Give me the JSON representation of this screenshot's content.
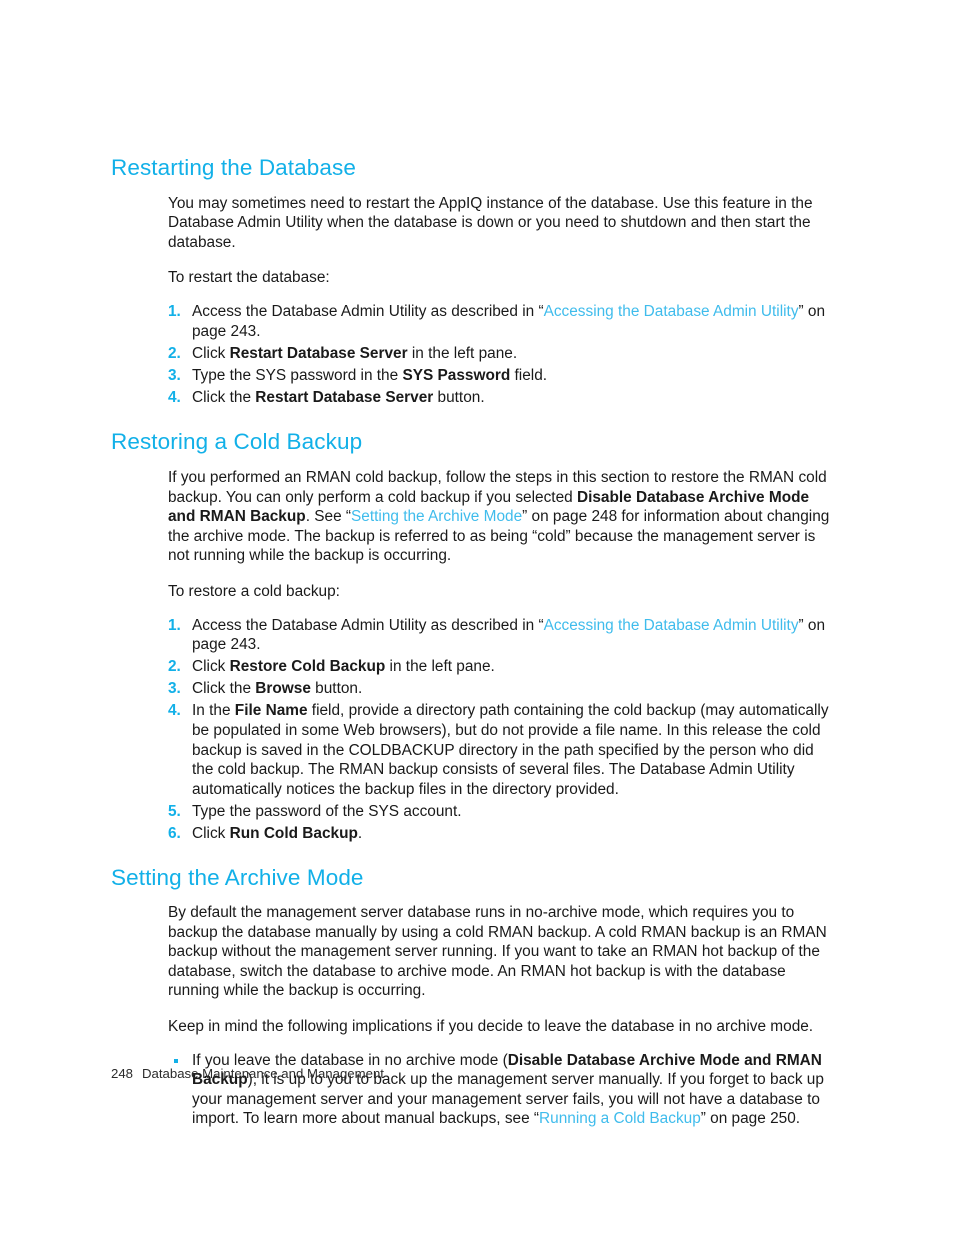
{
  "document": {
    "footer": {
      "page_number": "248",
      "chapter_title": "Database Maintenance and Management"
    }
  },
  "sections": [
    {
      "heading": "Restarting the Database",
      "intro": "You may sometimes need to restart the AppIQ instance of the database. Use this feature in the Database Admin Utility when the database is down or you need to shutdown and then start the database.",
      "lead_in": "To restart the database:",
      "steps": [
        {
          "number": "1.",
          "parts": [
            {
              "type": "text",
              "value": "Access the Database Admin Utility as described in “"
            },
            {
              "type": "xref",
              "value": "Accessing the Database Admin Utility"
            },
            {
              "type": "text",
              "value": "” on page 243."
            }
          ]
        },
        {
          "number": "2.",
          "parts": [
            {
              "type": "text",
              "value": "Click "
            },
            {
              "type": "bold",
              "value": "Restart Database Server"
            },
            {
              "type": "text",
              "value": " in the left pane."
            }
          ]
        },
        {
          "number": "3.",
          "parts": [
            {
              "type": "text",
              "value": "Type the SYS password in the "
            },
            {
              "type": "bold",
              "value": "SYS Password"
            },
            {
              "type": "text",
              "value": " field."
            }
          ]
        },
        {
          "number": "4.",
          "parts": [
            {
              "type": "text",
              "value": "Click the "
            },
            {
              "type": "bold",
              "value": "Restart Database Server"
            },
            {
              "type": "text",
              "value": " button."
            }
          ]
        }
      ]
    },
    {
      "heading": "Restoring a Cold Backup",
      "intro_parts": [
        {
          "type": "text",
          "value": "If you performed an RMAN cold backup, follow the steps in this section to restore the RMAN cold backup. You can only perform a cold backup if you selected "
        },
        {
          "type": "bold",
          "value": "Disable Database Archive Mode and RMAN Backup"
        },
        {
          "type": "text",
          "value": ". See “"
        },
        {
          "type": "xref",
          "value": "Setting the Archive Mode"
        },
        {
          "type": "text",
          "value": "” on page 248 for information about changing the archive mode. The backup is referred to as being “cold” because the management server is not running while the backup is occurring."
        }
      ],
      "lead_in": "To restore a cold backup:",
      "steps": [
        {
          "number": "1.",
          "parts": [
            {
              "type": "text",
              "value": "Access the Database Admin Utility as described in “"
            },
            {
              "type": "xref",
              "value": "Accessing the Database Admin Utility"
            },
            {
              "type": "text",
              "value": "” on page 243."
            }
          ]
        },
        {
          "number": "2.",
          "parts": [
            {
              "type": "text",
              "value": "Click "
            },
            {
              "type": "bold",
              "value": "Restore Cold Backup"
            },
            {
              "type": "text",
              "value": " in the left pane."
            }
          ]
        },
        {
          "number": "3.",
          "parts": [
            {
              "type": "text",
              "value": "Click the "
            },
            {
              "type": "bold",
              "value": "Browse"
            },
            {
              "type": "text",
              "value": " button."
            }
          ]
        },
        {
          "number": "4.",
          "parts": [
            {
              "type": "text",
              "value": "In the "
            },
            {
              "type": "bold",
              "value": "File Name"
            },
            {
              "type": "text",
              "value": " field, provide a directory path containing the cold backup (may automatically be populated in some Web browsers), but do not provide a file name. In this release the cold backup is saved in the COLDBACKUP directory in the path specified by the person who did the cold backup. The RMAN backup consists of several files. The Database Admin Utility automatically notices the backup files in the directory provided."
            }
          ]
        },
        {
          "number": "5.",
          "parts": [
            {
              "type": "text",
              "value": "Type the password of the SYS account."
            }
          ]
        },
        {
          "number": "6.",
          "parts": [
            {
              "type": "text",
              "value": "Click "
            },
            {
              "type": "bold",
              "value": "Run Cold Backup"
            },
            {
              "type": "text",
              "value": "."
            }
          ]
        }
      ]
    },
    {
      "heading": "Setting the Archive Mode",
      "intro": "By default the management server database runs in no-archive mode, which requires you to backup the database manually by using a cold RMAN backup. A cold RMAN backup is an RMAN backup without the management server running. If you want to take an RMAN hot backup of the database, switch the database to archive mode. An RMAN hot backup is with the database running while the backup is occurring.",
      "lead_in": "Keep in mind the following implications if you decide to leave the database in no archive mode.",
      "bullets": [
        {
          "parts": [
            {
              "type": "text",
              "value": "If you leave the database in no archive mode ("
            },
            {
              "type": "bold",
              "value": "Disable Database Archive Mode and RMAN Backup"
            },
            {
              "type": "text",
              "value": "), it is up to you to back up the management server manually. If you forget to back up your management server and your management server fails, you will not have a database to import. To learn more about manual backups, see “"
            },
            {
              "type": "xref",
              "value": "Running a Cold Backup"
            },
            {
              "type": "text",
              "value": "” on page 250."
            }
          ]
        }
      ]
    }
  ],
  "colors": {
    "heading": "#12B0E8",
    "link": "#3FBCEC",
    "body_text": "#1a1a1a",
    "bullet": "#12B0E8"
  }
}
